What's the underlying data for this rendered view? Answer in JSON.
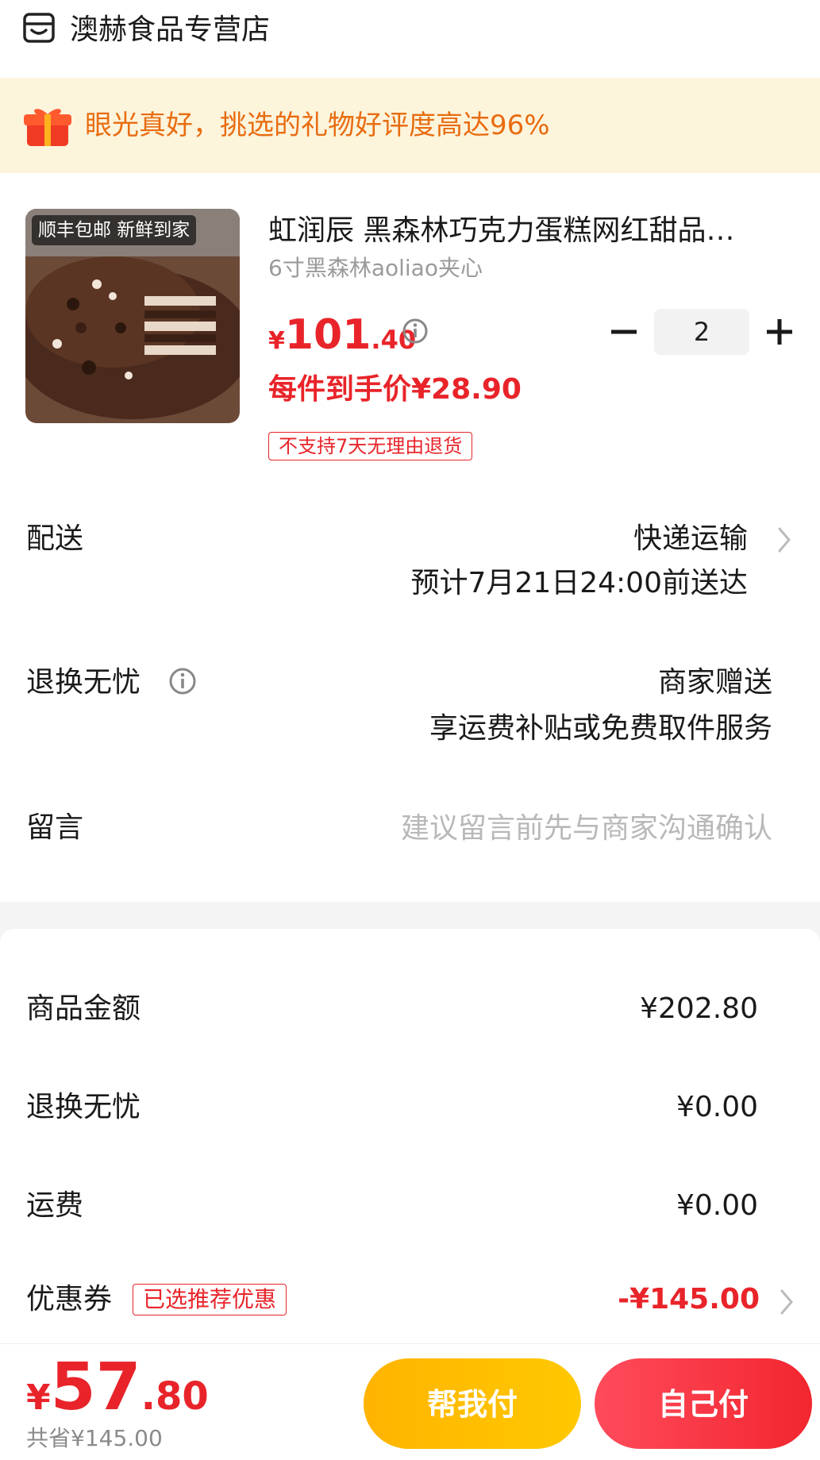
{
  "shop": {
    "name": "澳赫食品专营店",
    "icon": "store-icon"
  },
  "promo": {
    "text": "眼光真好，挑选的礼物好评度高达96%",
    "icon": "gift-icon",
    "color": "#e86c10",
    "background": "#fdf4dc"
  },
  "product": {
    "image_banner": "顺丰包邮 新鲜到家",
    "title": "虹润辰 黑森林巧克力蛋糕网红甜品…",
    "spec": "6寸黑森林aoliao夹心",
    "price": {
      "symbol": "¥",
      "integer": "101",
      "decimal": ".40"
    },
    "price_info_icon": "info-icon",
    "quantity": "2",
    "unit_price": "每件到手价¥28.90",
    "return_tag": "不支持7天无理由退货"
  },
  "delivery": {
    "label": "配送",
    "method": "快递运输",
    "eta": "预计7月21日24:00前送达"
  },
  "worry_free": {
    "label": "退换无忧",
    "value": "商家赠送",
    "desc": "享运费补贴或免费取件服务"
  },
  "message": {
    "label": "留言",
    "placeholder": "建议留言前先与商家沟通确认"
  },
  "summary": {
    "goods_amount": {
      "label": "商品金额",
      "value": "¥202.80"
    },
    "worry_free": {
      "label": "退换无忧",
      "value": "¥0.00"
    },
    "shipping": {
      "label": "运费",
      "value": "¥0.00"
    },
    "coupon": {
      "label": "优惠券",
      "tag": "已选推荐优惠",
      "value": "-¥145.00"
    }
  },
  "bottom": {
    "total": {
      "symbol": "¥",
      "integer": "57",
      "decimal": ".80"
    },
    "saved": "共省¥145.00",
    "help_pay": "帮我付",
    "self_pay": "自己付"
  },
  "colors": {
    "accent_red": "#e8242a",
    "help_pay": "#ffb400",
    "self_pay": "#f2262f"
  }
}
